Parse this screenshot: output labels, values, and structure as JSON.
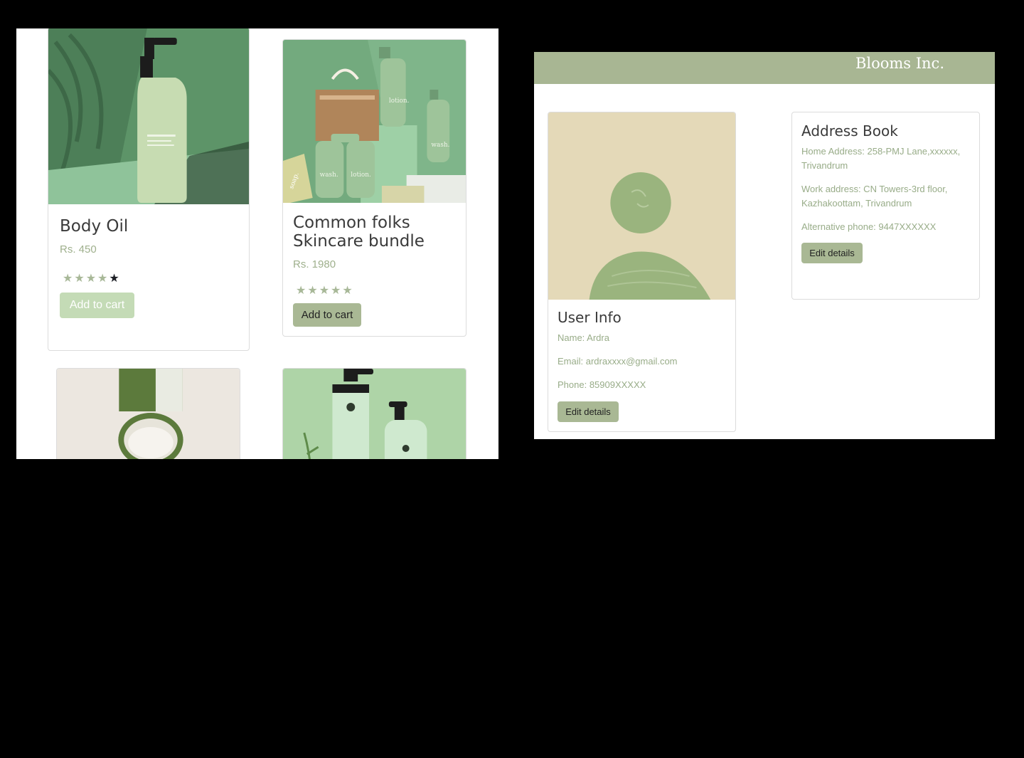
{
  "shop": {
    "products": [
      {
        "title": "Body Oil",
        "price": "Rs. 450",
        "rating": 4,
        "button": "Add to cart",
        "image": "pump-bottle-with-palm-shadow"
      },
      {
        "title": "Common folks Skincare bundle",
        "price": "Rs. 1980",
        "rating": 5,
        "button": "Add to cart",
        "image": "skincare-bundle-set",
        "image_labels": {
          "lotion": "lotion.",
          "wash": "wash.",
          "soap": "soap."
        }
      },
      {
        "image": "cream-jar"
      },
      {
        "image": "pump-bottles-with-rosemary"
      }
    ],
    "star_glyph": "★"
  },
  "profile": {
    "brand": "Blooms Inc.",
    "user_info": {
      "title": "User Info",
      "name": "Name: Ardra",
      "email": "Email: ardraxxxx@gmail.com",
      "phone": "Phone: 85909XXXXX",
      "button": "Edit details",
      "image": "abstract-green-shapes-on-beige"
    },
    "address_book": {
      "title": "Address Book",
      "home": "Home Address: 258-PMJ Lane,xxxxxx, Trivandrum",
      "work": "Work address: CN Towers-3rd floor, Kazhakoottam, Trivandrum",
      "alt_phone": "Alternative phone: 9447XXXXXX",
      "button": "Edit details"
    }
  },
  "colors": {
    "accent": "#a8b693",
    "button_light": "#c4dbb6",
    "price_text": "#9fb08d",
    "star_empty": "#a8b898",
    "star_dark": "#1e2026"
  }
}
